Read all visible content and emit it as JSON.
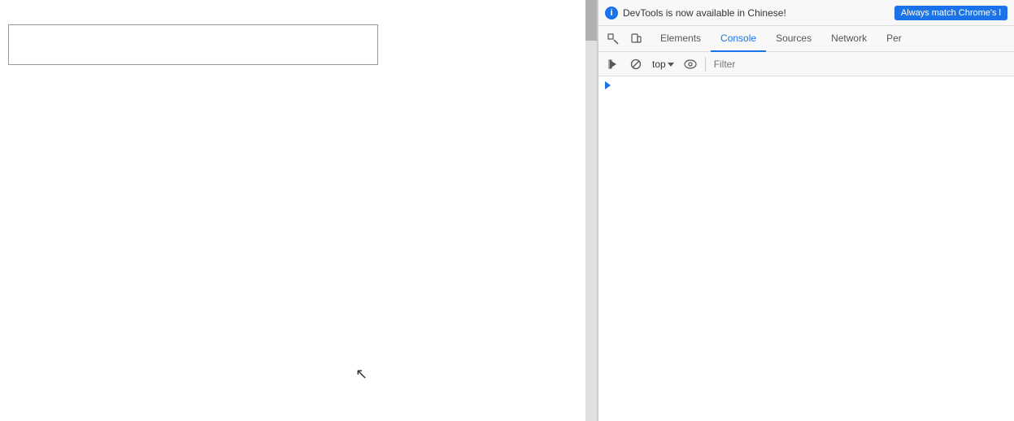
{
  "page": {
    "input_placeholder": ""
  },
  "devtools": {
    "notification": {
      "text": "DevTools is now available in Chinese!",
      "button_label": "Always match Chrome's l",
      "icon_label": "i"
    },
    "tabs": [
      {
        "label": "Elements",
        "active": false
      },
      {
        "label": "Console",
        "active": true
      },
      {
        "label": "Sources",
        "active": false
      },
      {
        "label": "Network",
        "active": false
      },
      {
        "label": "Per",
        "active": false
      }
    ],
    "toolbar": {
      "context_label": "top",
      "filter_placeholder": "Filter",
      "play_icon": "▶",
      "block_icon": "⊘",
      "eye_icon": "👁",
      "inspect_icon": "⬚",
      "device_icon": "📱"
    },
    "console": {
      "prompt_symbol": ">"
    }
  }
}
